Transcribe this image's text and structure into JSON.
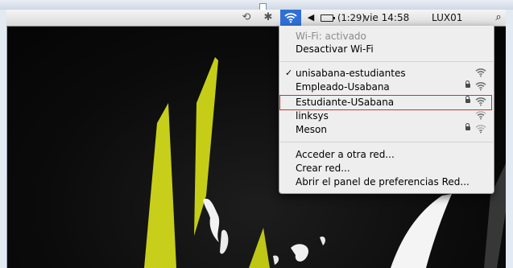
{
  "menubar": {
    "battery_time": "(1:29)",
    "clock": "vie 14:58",
    "user": "LUX01"
  },
  "wifi_menu": {
    "status": "Wi-Fi: activado",
    "toggle": "Desactivar Wi-Fi",
    "networks": [
      {
        "name": "unisabana-estudiantes",
        "connected": true,
        "locked": false
      },
      {
        "name": "Empleado-Usabana",
        "connected": false,
        "locked": true
      },
      {
        "name": "Estudiante-USabana",
        "connected": false,
        "locked": true,
        "highlighted": true
      },
      {
        "name": "linksys",
        "connected": false,
        "locked": false
      },
      {
        "name": "Meson",
        "connected": false,
        "locked": true
      }
    ],
    "actions": {
      "join_other": "Acceder a otra red...",
      "create": "Crear red...",
      "open_prefs": "Abrir el panel de preferencias Red..."
    }
  },
  "icons": {
    "time_machine": "time-machine-icon",
    "bluetooth": "bluetooth-icon",
    "wifi": "wifi-icon",
    "volume": "volume-icon",
    "battery": "battery-icon",
    "spotlight": "spotlight-search-icon",
    "lock": "lock-icon",
    "signal": "wifi-signal-icon"
  },
  "colors": {
    "menubar_highlight": "#2f6fd6",
    "selection_outline": "#c83232",
    "wallpaper_accent": "#c8cf1a"
  }
}
